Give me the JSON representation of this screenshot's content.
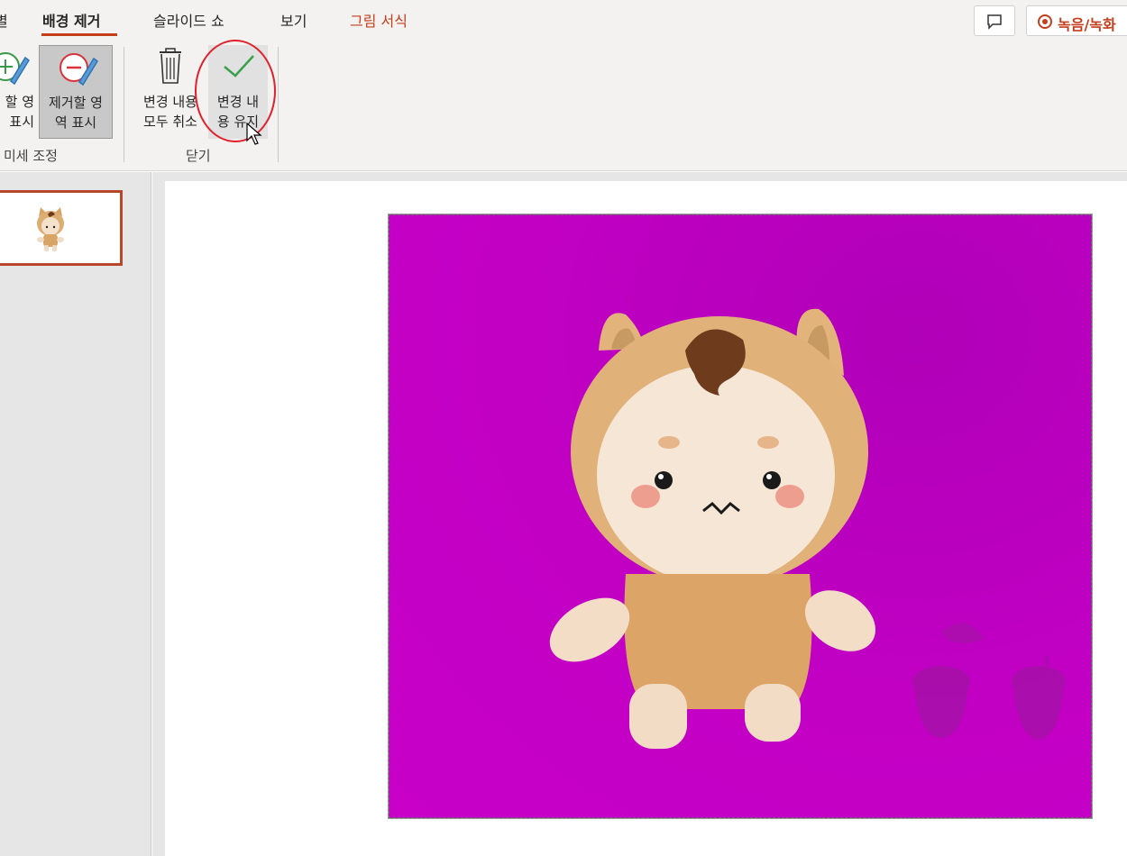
{
  "tabs": {
    "prev_partial": "별",
    "background_removal": "배경 제거",
    "slideshow": "슬라이드 쇼",
    "view": "보기",
    "picture_format": "그림 서식"
  },
  "record_button": {
    "label": "녹음/녹화"
  },
  "ribbon": {
    "mark_keep": {
      "label": "할 영\n표시"
    },
    "mark_remove": {
      "label": "제거할 영\n역 표시"
    },
    "discard_changes": {
      "label": "변경 내용\n모두 취소"
    },
    "keep_changes": {
      "label": "변경 내\n용 유지"
    },
    "refine_group_label": "미세 조정",
    "close_group_label": "닫기"
  },
  "colors": {
    "accent": "#c43e1c",
    "removal_overlay": "#c200c4",
    "annotation": "#e0202a"
  },
  "icons": {
    "mark_keep": "pencil-plus-icon",
    "mark_remove": "pencil-minus-icon",
    "discard": "trash-icon",
    "keep": "checkmark-icon",
    "comment": "comment-icon",
    "record": "record-icon"
  }
}
